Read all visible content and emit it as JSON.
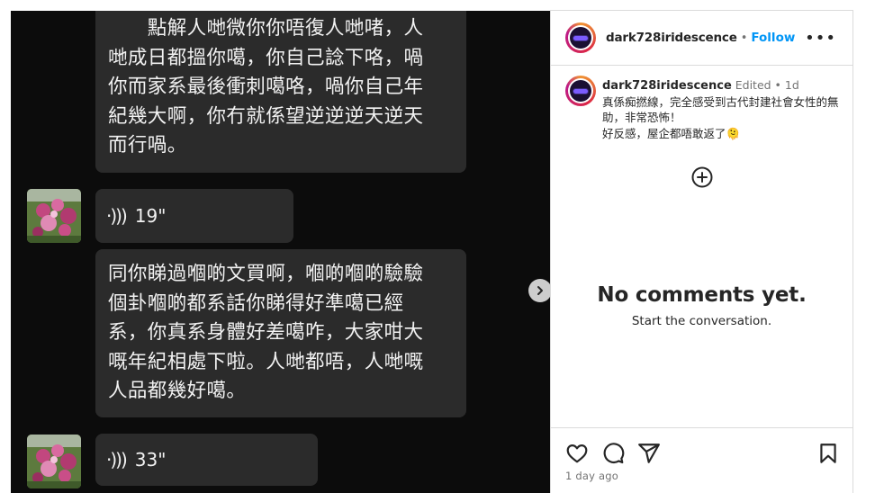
{
  "chat": {
    "bubble1_lines": [
      "　　點解人哋微你你唔復人哋啫，人",
      "哋成日都搵你噶，你自己諗下咯，喎",
      "你而家系最後衝刺噶咯，喎你自己年",
      "紀幾大啊，你冇就係望逆逆逆天逆天",
      "而行喎。"
    ],
    "voice1_duration": "19\"",
    "bubble2_lines": [
      "同你睇過嗰啲文買啊，嗰啲嗰啲驗驗",
      "個卦嗰啲都系話你睇得好準噶已經",
      "系，你真系身體好差噶咋，大家咁大",
      "嘅年紀相處下啦。人哋都唔，人哋嘅",
      "人品都幾好噶。"
    ],
    "voice2_duration": "33\""
  },
  "post": {
    "username": "dark728iridescence",
    "separator": "•",
    "follow_label": "Follow",
    "more_label": "•••",
    "caption_username": "dark728iridescence",
    "caption_meta": "Edited • 1d",
    "caption_body": "真係痴撚線，完全感受到古代封建社會女性的無助，非常恐怖！\n好反感，屋企都唔敢返了🫠",
    "no_comments_title": "No comments yet.",
    "no_comments_sub": "Start the conversation.",
    "date": "1 day ago"
  },
  "icons": {
    "add_comment": "plus-circle-icon",
    "like": "heart-icon",
    "comment": "comment-icon",
    "share": "paper-plane-icon",
    "save": "bookmark-icon",
    "next": "chevron-right-icon",
    "voice": "sound-wave-icon"
  },
  "colors": {
    "accent": "#0095f6",
    "chat_background": "#0c0c0c",
    "bubble": "#2b2b2b",
    "text_muted": "#737373"
  }
}
